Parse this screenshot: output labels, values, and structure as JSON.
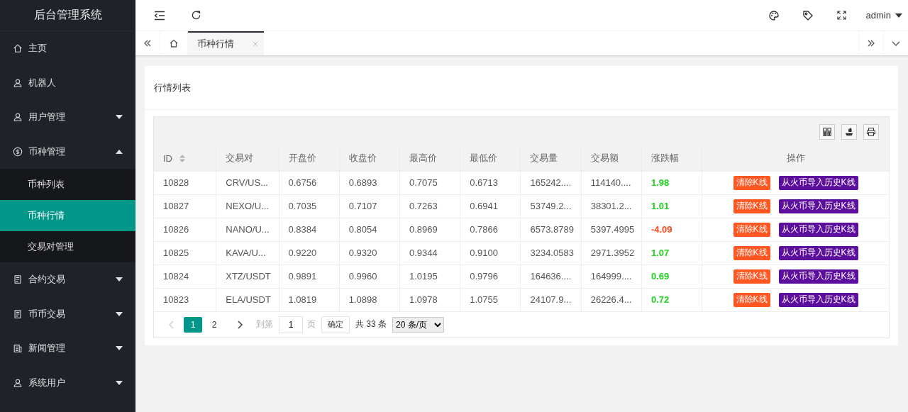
{
  "sidebar": {
    "title": "后台管理系统",
    "items": [
      {
        "label": "主页",
        "kind": "link"
      },
      {
        "label": "机器人",
        "kind": "link"
      },
      {
        "label": "用户管理",
        "kind": "group",
        "expanded": false
      },
      {
        "label": "币种管理",
        "kind": "group",
        "expanded": true,
        "children": [
          {
            "label": "币种列表",
            "selected": false
          },
          {
            "label": "币种行情",
            "selected": true
          },
          {
            "label": "交易对管理",
            "selected": false
          }
        ]
      },
      {
        "label": "合约交易",
        "kind": "group",
        "expanded": false
      },
      {
        "label": "币币交易",
        "kind": "group",
        "expanded": false
      },
      {
        "label": "新闻管理",
        "kind": "group",
        "expanded": false
      },
      {
        "label": "系统用户",
        "kind": "group",
        "expanded": false
      }
    ]
  },
  "header": {
    "user": "admin"
  },
  "tabs": [
    {
      "label": "币种行情",
      "selected": true
    }
  ],
  "card": {
    "title": "行情列表"
  },
  "table": {
    "columns": [
      {
        "label": "ID",
        "sortable": true
      },
      {
        "label": "交易对",
        "sortable": false
      },
      {
        "label": "开盘价",
        "sortable": false
      },
      {
        "label": "收盘价",
        "sortable": false
      },
      {
        "label": "最高价",
        "sortable": false
      },
      {
        "label": "最低价",
        "sortable": false
      },
      {
        "label": "交易量",
        "sortable": false
      },
      {
        "label": "交易额",
        "sortable": false
      },
      {
        "label": "涨跌幅",
        "sortable": false
      },
      {
        "label": "操作",
        "sortable": false
      }
    ],
    "rows": [
      {
        "cells": [
          "10828",
          "CRV/US...",
          "0.6756",
          "0.6893",
          "0.7075",
          "0.6713",
          "165242....",
          "114140...."
        ],
        "change": {
          "text": "1.98",
          "color": "#1fd11f"
        },
        "actions": [
          {
            "label": "清除K线",
            "kind": "clear"
          },
          {
            "label": "从火币导入历史K线",
            "kind": "import"
          }
        ]
      },
      {
        "cells": [
          "10827",
          "NEXO/U...",
          "0.7035",
          "0.7107",
          "0.7263",
          "0.6941",
          "53749.2...",
          "38301.2..."
        ],
        "change": {
          "text": "1.01",
          "color": "#1fd11f"
        },
        "actions": [
          {
            "label": "清除K线",
            "kind": "clear"
          },
          {
            "label": "从火币导入历史K线",
            "kind": "import"
          }
        ]
      },
      {
        "cells": [
          "10826",
          "NANO/U...",
          "0.8384",
          "0.8054",
          "0.8969",
          "0.7866",
          "6573.8789",
          "5397.4995"
        ],
        "change": {
          "text": "-4.09",
          "color": "#ff4a1f"
        },
        "actions": [
          {
            "label": "清除K线",
            "kind": "clear"
          },
          {
            "label": "从火币导入历史K线",
            "kind": "import"
          }
        ]
      },
      {
        "cells": [
          "10825",
          "KAVA/U...",
          "0.9220",
          "0.9320",
          "0.9344",
          "0.9100",
          "3234.0583",
          "2971.3952"
        ],
        "change": {
          "text": "1.07",
          "color": "#1fd11f"
        },
        "actions": [
          {
            "label": "清除K线",
            "kind": "clear"
          },
          {
            "label": "从火币导入历史K线",
            "kind": "import"
          }
        ]
      },
      {
        "cells": [
          "10824",
          "XTZ/USDT",
          "0.9891",
          "0.9960",
          "1.0195",
          "0.9796",
          "164636....",
          "164999...."
        ],
        "change": {
          "text": "0.69",
          "color": "#1fd11f"
        },
        "actions": [
          {
            "label": "清除K线",
            "kind": "clear"
          },
          {
            "label": "从火币导入历史K线",
            "kind": "import"
          }
        ]
      },
      {
        "cells": [
          "10823",
          "ELA/USDT",
          "1.0819",
          "1.0898",
          "1.0978",
          "1.0755",
          "24107.9...",
          "26226.4..."
        ],
        "change": {
          "text": "0.72",
          "color": "#1fd11f"
        },
        "actions": [
          {
            "label": "清除K线",
            "kind": "clear"
          },
          {
            "label": "从火币导入历史K线",
            "kind": "import"
          }
        ]
      }
    ]
  },
  "pager": {
    "pages": [
      {
        "label": "1",
        "selected": true
      },
      {
        "label": "2",
        "selected": false
      }
    ],
    "goto_label": "到第",
    "page_input": "1",
    "page_unit": "页",
    "confirm": "确定",
    "total": "共 33 条",
    "page_size": "20 条/页"
  }
}
